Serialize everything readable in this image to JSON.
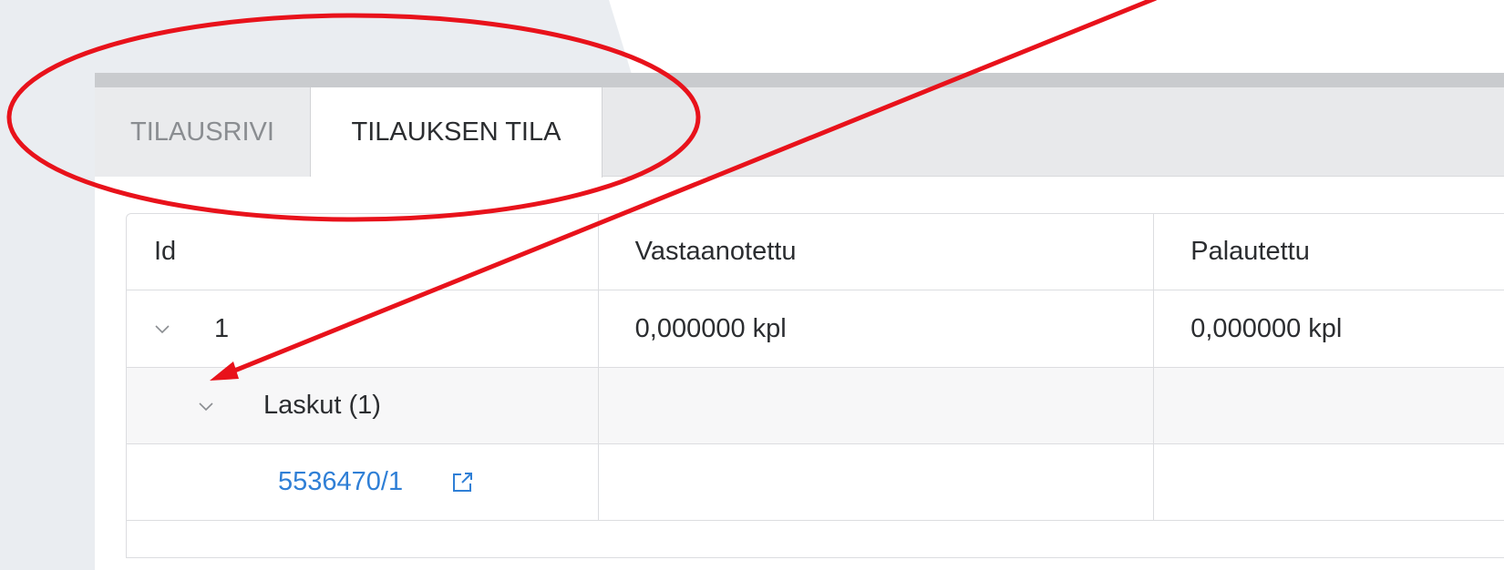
{
  "tabs": [
    {
      "label": "TILAUSRIVI",
      "active": false
    },
    {
      "label": "TILAUKSEN TILA",
      "active": true
    }
  ],
  "table": {
    "columns": [
      "Id",
      "Vastaanotettu",
      "Palautettu"
    ],
    "rows": [
      {
        "id": "1",
        "received": "0,000000 kpl",
        "returned": "0,000000 kpl"
      }
    ],
    "group_label": "Laskut (1)",
    "invoice_link": "5536470/1"
  },
  "colors": {
    "link": "#2f7fd6",
    "annotation": "#e8121b",
    "page_background": "#eaedf1"
  },
  "icons": {
    "expand": "chevron-down-icon",
    "external": "external-link-icon"
  }
}
